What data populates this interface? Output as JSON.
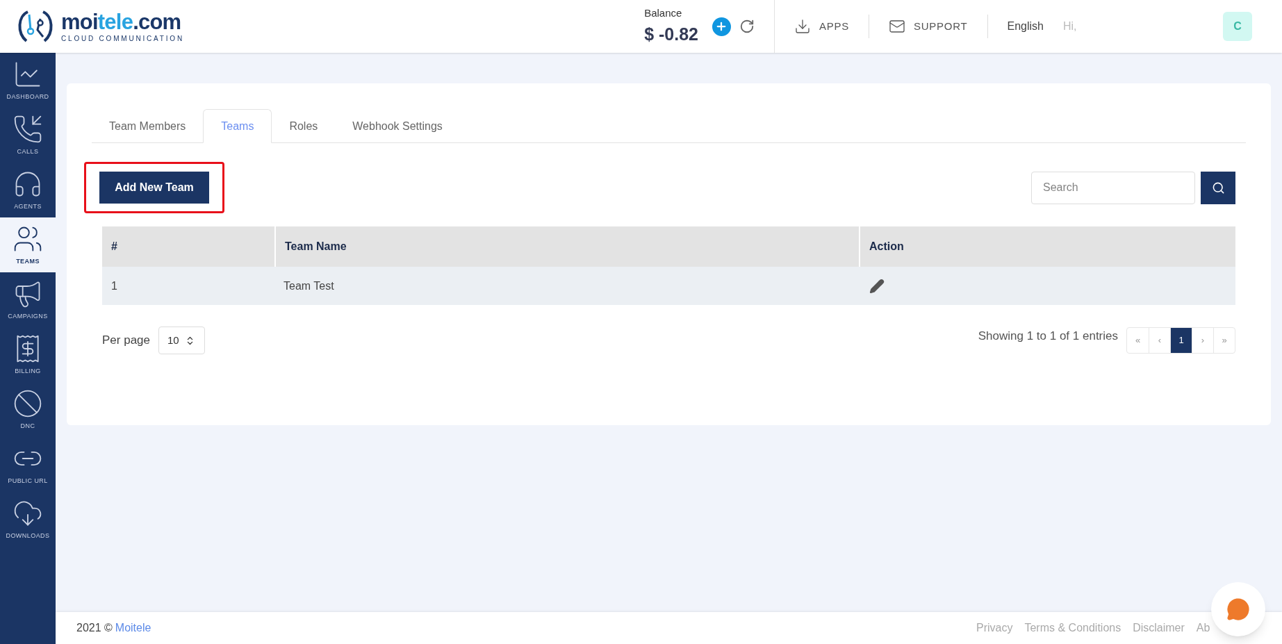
{
  "header": {
    "logo": {
      "name_a": "moi",
      "name_b": "tele",
      "name_c": ".com",
      "tagline": "CLOUD COMMUNICATION"
    },
    "balance_label": "Balance",
    "balance": "$ -0.82",
    "links": [
      {
        "kind": "apps",
        "label": "APPS"
      },
      {
        "kind": "support",
        "label": "SUPPORT"
      }
    ],
    "language": "English",
    "greeting": "Hi,",
    "avatar": "C"
  },
  "sidebar": {
    "items": [
      {
        "kind": "dashboard",
        "label": "DASHBOARD",
        "selected": false
      },
      {
        "kind": "calls",
        "label": "CALLS",
        "selected": false
      },
      {
        "kind": "agents",
        "label": "AGENTS",
        "selected": false
      },
      {
        "kind": "teams",
        "label": "TEAMS",
        "selected": true
      },
      {
        "kind": "campaigns",
        "label": "CAMPAIGNS",
        "selected": false
      },
      {
        "kind": "billing",
        "label": "BILLING",
        "selected": false
      },
      {
        "kind": "dnc",
        "label": "DNC",
        "selected": false
      },
      {
        "kind": "public_url",
        "label": "PUBLIC URL",
        "selected": false
      },
      {
        "kind": "downloads",
        "label": "DOWNLOADS",
        "selected": false
      }
    ]
  },
  "tabs": [
    {
      "label": "Team Members",
      "selected": false
    },
    {
      "label": "Teams",
      "selected": true
    },
    {
      "label": "Roles",
      "selected": false
    },
    {
      "label": "Webhook Settings",
      "selected": false
    }
  ],
  "add_button": "Add New Team",
  "search": {
    "placeholder": "Search"
  },
  "table": {
    "columns": [
      "#",
      "Team Name",
      "Action"
    ],
    "rows": [
      {
        "number": "1",
        "team_name": "Team Test"
      }
    ]
  },
  "per_page": {
    "label": "Per page",
    "value": "10"
  },
  "entries": "Showing 1 to 1 of 1 entries",
  "pagination": [
    {
      "label": "«",
      "selected": false
    },
    {
      "label": "‹",
      "selected": false
    },
    {
      "label": "1",
      "selected": true
    },
    {
      "label": "›",
      "selected": false
    },
    {
      "label": "»",
      "selected": false
    }
  ],
  "footer": {
    "year": "2021 ©",
    "brand": "Moitele",
    "links": [
      "Privacy",
      "Terms & Conditions",
      "Disclaimer",
      "Ab"
    ]
  }
}
